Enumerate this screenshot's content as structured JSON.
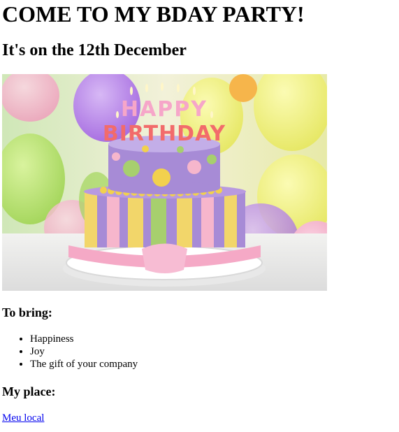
{
  "heading": "COME TO MY BDAY PARTY!",
  "subheading": "It's on the 12th December",
  "image": {
    "cake_letters_top": "HAPPY",
    "cake_letters_bottom": "BIRTHDAY"
  },
  "bring": {
    "title": "To bring:",
    "items": [
      "Happiness",
      "Joy",
      "The gift of your company"
    ]
  },
  "place": {
    "title": "My place:",
    "link_text": "Meu local"
  },
  "colors": {
    "link": "#0000ee",
    "cake_purple": "#a78bd6",
    "cake_pink": "#f6b6cc",
    "cake_yellow": "#f2d66a",
    "cake_green": "#a7cf6e"
  }
}
